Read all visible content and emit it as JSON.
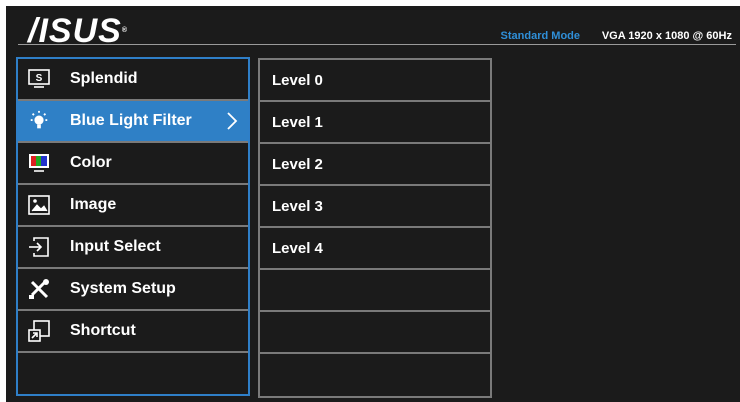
{
  "header": {
    "logo": "/ISUS",
    "registered": "®",
    "mode": "Standard Mode",
    "signal": "VGA  1920 x 1080 @ 60Hz"
  },
  "colors": {
    "accent": "#2f80c6",
    "mode_text": "#2f8fd8",
    "background": "#1b1b1b",
    "divider": "#7a7a7a"
  },
  "main_menu": {
    "selected_index": 1,
    "items": [
      {
        "label": "Splendid",
        "icon": "splendid-icon"
      },
      {
        "label": "Blue Light Filter",
        "icon": "bulb-icon"
      },
      {
        "label": "Color",
        "icon": "color-icon"
      },
      {
        "label": "Image",
        "icon": "image-icon"
      },
      {
        "label": "Input Select",
        "icon": "input-select-icon"
      },
      {
        "label": "System Setup",
        "icon": "tools-icon"
      },
      {
        "label": "Shortcut",
        "icon": "shortcut-icon"
      },
      {
        "label": "",
        "icon": ""
      }
    ]
  },
  "sub_menu": {
    "items": [
      {
        "label": "Level 0"
      },
      {
        "label": "Level 1"
      },
      {
        "label": "Level 2"
      },
      {
        "label": "Level 3"
      },
      {
        "label": "Level 4"
      },
      {
        "label": ""
      },
      {
        "label": ""
      },
      {
        "label": ""
      }
    ]
  }
}
